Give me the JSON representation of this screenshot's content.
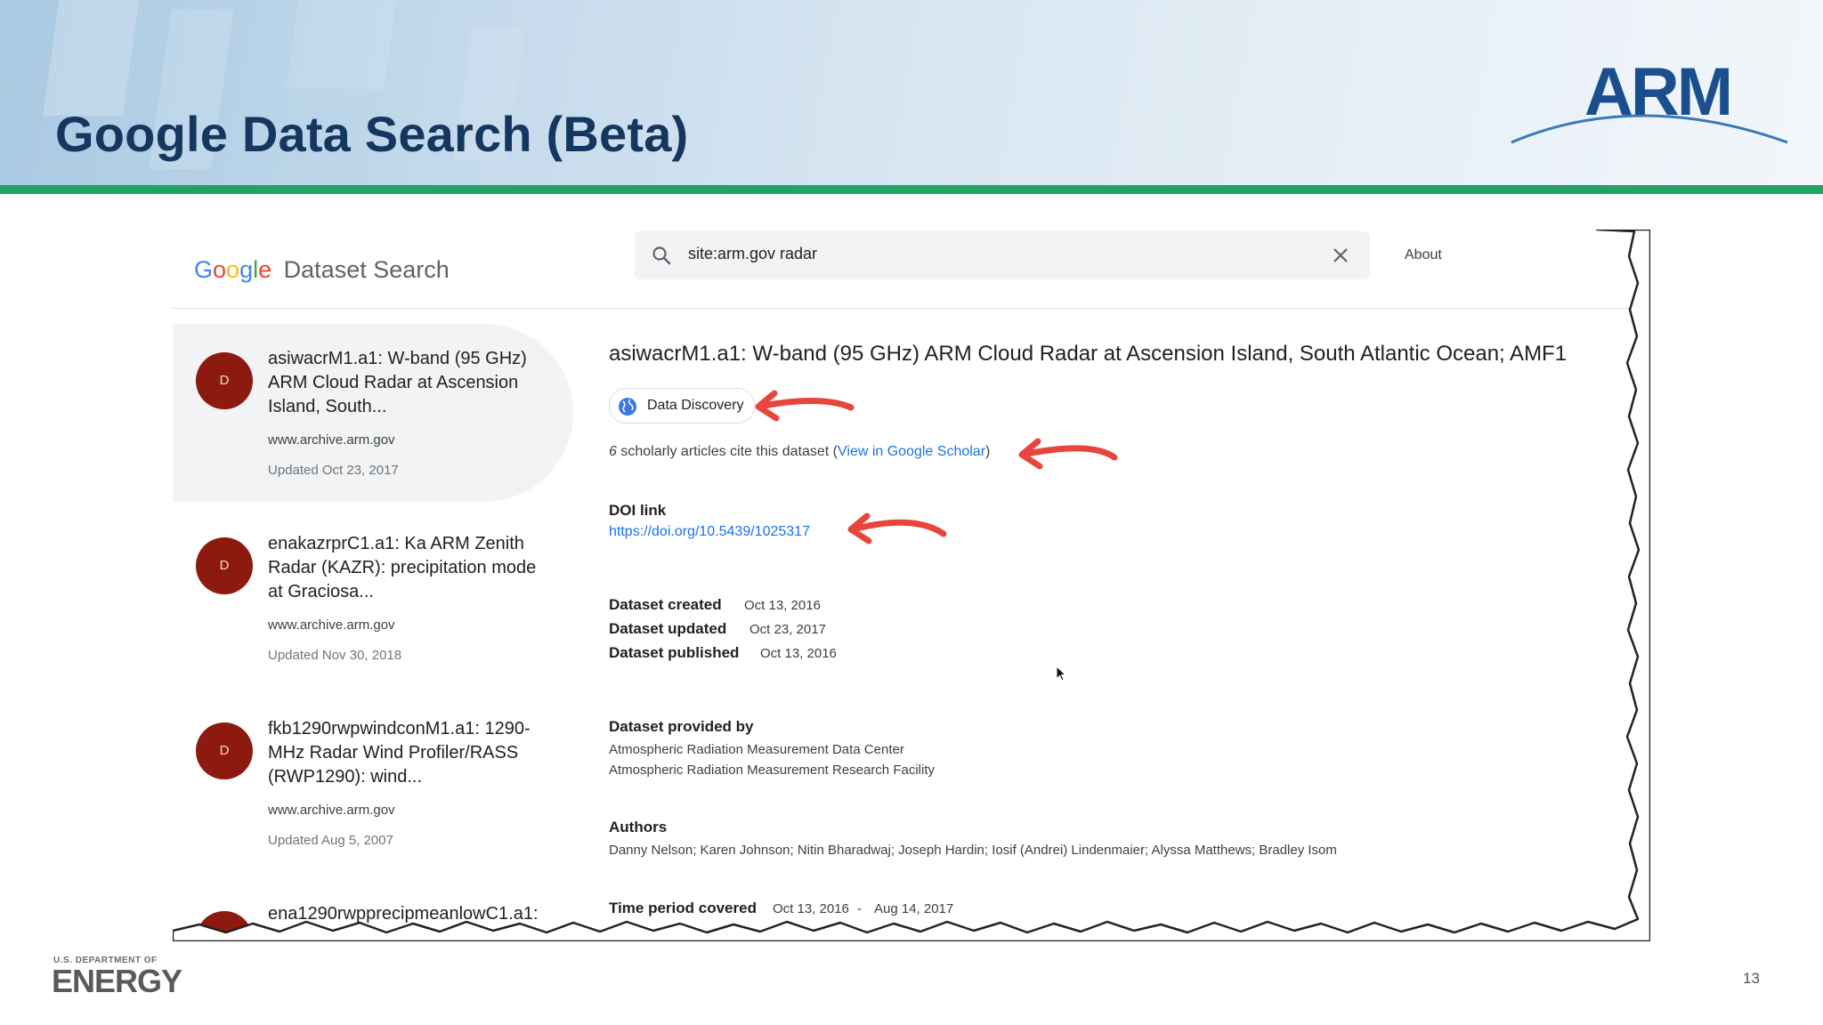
{
  "slide": {
    "title": "Google Data Search (Beta)",
    "logo_text": "ARM",
    "doe_small": "U.S. DEPARTMENT OF",
    "doe_big": "ENERGY",
    "page_number": "13"
  },
  "app": {
    "logo_letters": [
      "G",
      "o",
      "o",
      "g",
      "l",
      "e"
    ],
    "product_name": "Dataset Search",
    "search_query": "site:arm.gov radar",
    "about_label": "About"
  },
  "results": [
    {
      "avatar": "D",
      "title": "asiwacrM1.a1: W-band (95 GHz) ARM Cloud Radar at Ascension Island, South...",
      "source": "www.archive.arm.gov",
      "updated": "Updated Oct 23, 2017"
    },
    {
      "avatar": "D",
      "title": "enakazrprC1.a1: Ka ARM Zenith Radar (KAZR): precipitation mode at Graciosa...",
      "source": "www.archive.arm.gov",
      "updated": "Updated Nov 30, 2018"
    },
    {
      "avatar": "D",
      "title": "fkb1290rwpwindconM1.a1: 1290-MHz Radar Wind Profiler/RASS (RWP1290): wind...",
      "source": "www.archive.arm.gov",
      "updated": "Updated Aug 5, 2007"
    },
    {
      "avatar": "D",
      "title": "ena1290rwpprecipmeanlowC1.a1:",
      "source": "",
      "updated": ""
    }
  ],
  "detail": {
    "title": "asiwacrM1.a1: W-band (95 GHz) ARM Cloud Radar at Ascension Island, South Atlantic Ocean; AMF1",
    "chip_label": "Data Discovery",
    "cite_count": "6",
    "cite_text": " scholarly articles cite this dataset (",
    "cite_link": "View in Google Scholar",
    "cite_close": ")",
    "doi_label": "DOI link",
    "doi_url": "https://doi.org/10.5439/1025317",
    "created_label": "Dataset created",
    "created_value": "Oct 13, 2016",
    "updated_label": "Dataset updated",
    "updated_value": "Oct 23, 2017",
    "published_label": "Dataset published",
    "published_value": "Oct 13, 2016",
    "provided_label": "Dataset provided by",
    "provider_1": "Atmospheric Radiation Measurement Data Center",
    "provider_2": "Atmospheric Radiation Measurement Research Facility",
    "authors_label": "Authors",
    "authors_value": "Danny Nelson; Karen Johnson; Nitin Bharadwaj; Joseph Hardin; Iosif (Andrei) Lindenmaier; Alyssa Matthews; Bradley Isom",
    "time_label": "Time period covered",
    "time_start": "Oct 13, 2016",
    "time_sep": "-",
    "time_end": "Aug 14, 2017"
  },
  "colors": {
    "title_navy": "#14365f",
    "rule_green": "#1fa463",
    "avatar_red": "#8c1a0e",
    "link_blue": "#1a73e8",
    "arrow_red": "#e8453c"
  }
}
